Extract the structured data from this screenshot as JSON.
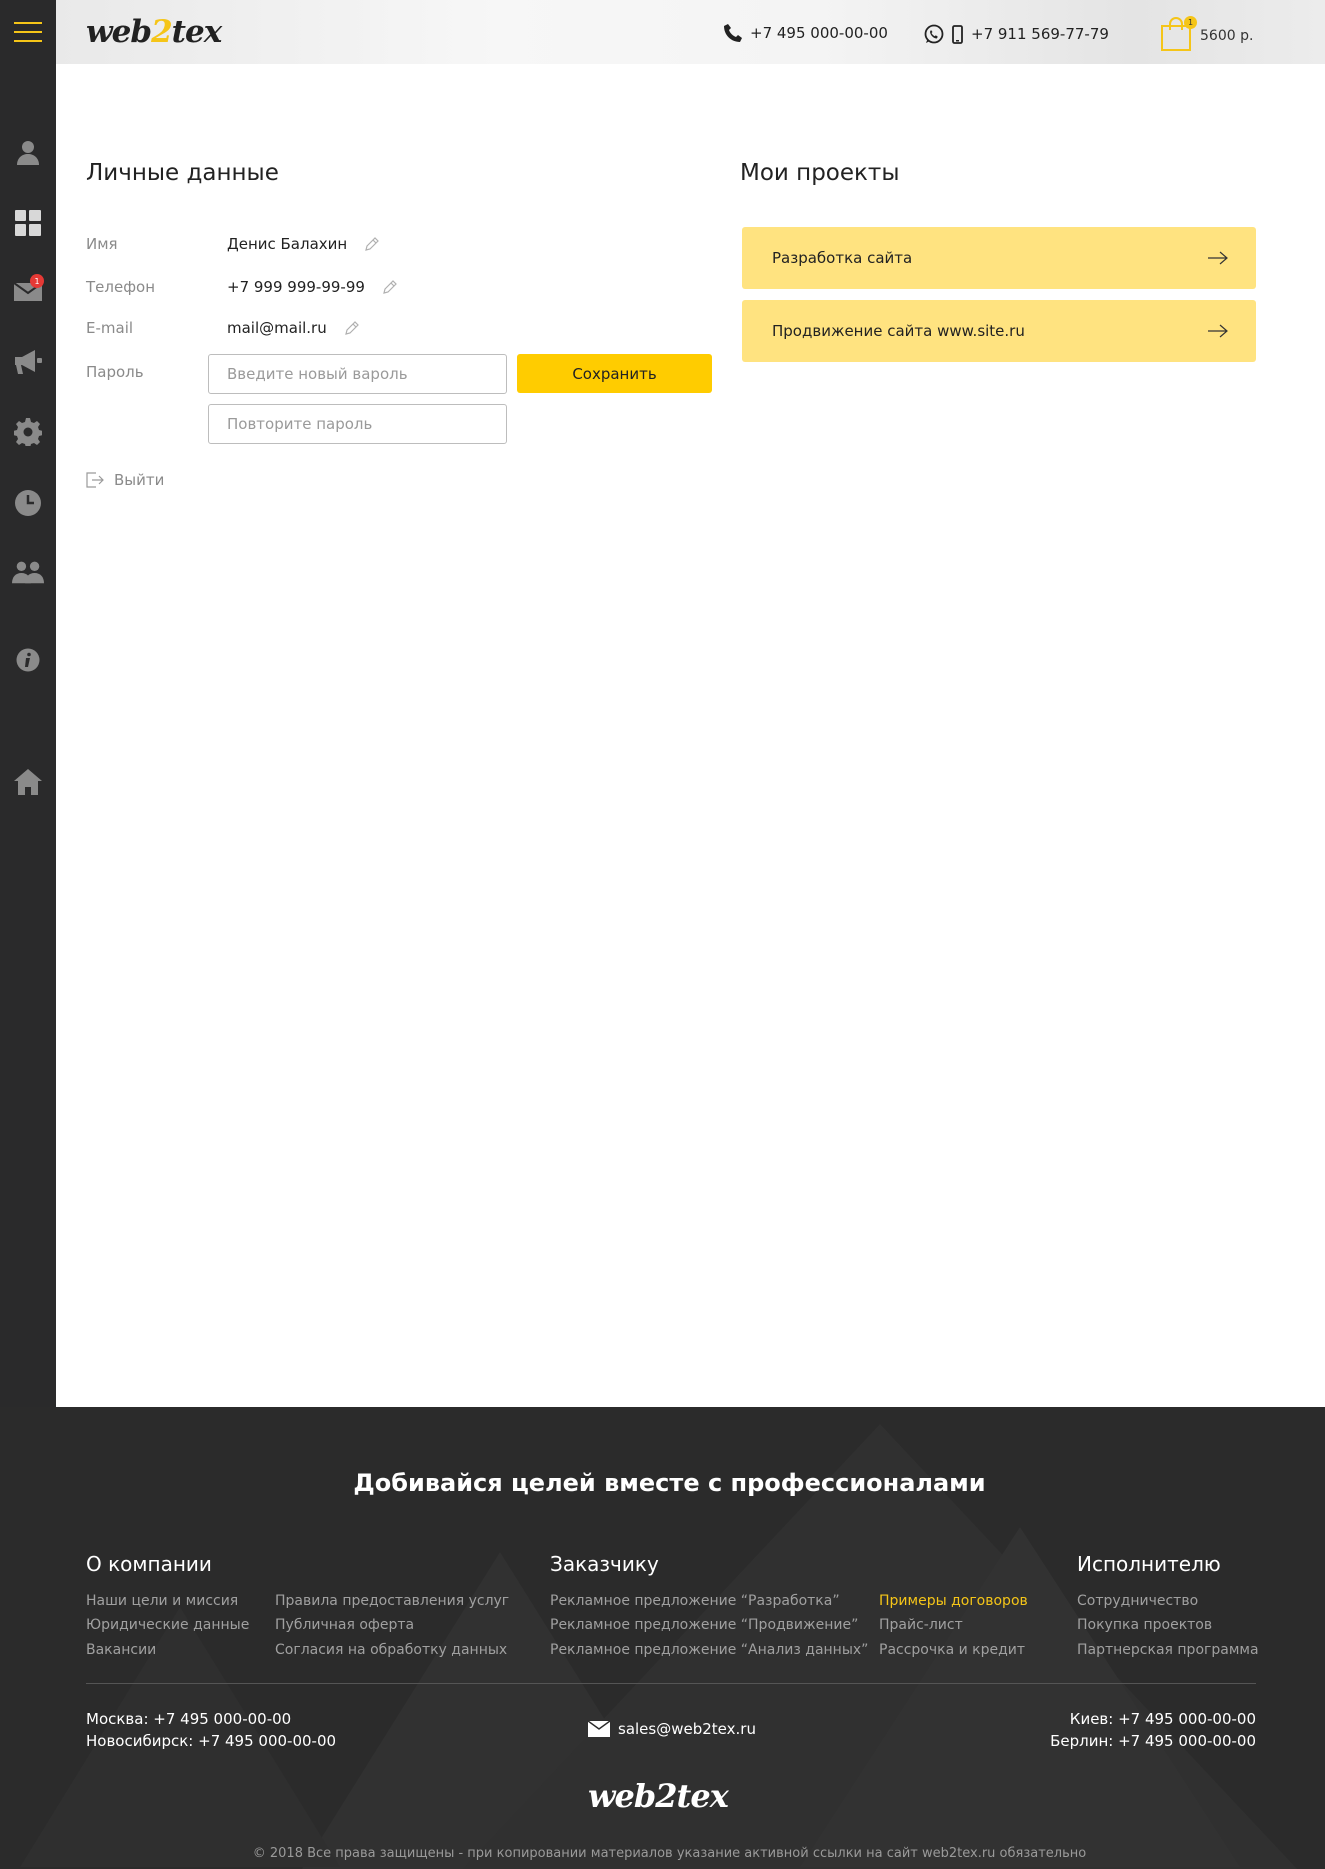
{
  "header": {
    "logo_pre": "web",
    "logo_two": "2",
    "logo_post": "tex",
    "phone_main": "+7 495 000-00-00",
    "phone_mobile": "+7 911 569-77-79",
    "cart_count": "1",
    "cart_sum": "5600 р."
  },
  "sidebar": {
    "icons": [
      "menu-icon",
      "user-icon",
      "dashboard-icon",
      "mail-icon",
      "megaphone-icon",
      "gear-icon",
      "clock-icon",
      "users-icon",
      "info-icon",
      "home-icon"
    ],
    "mail_badge": "1"
  },
  "personal": {
    "title": "Личные данные",
    "name_label": "Имя",
    "name_value": "Денис Балахин",
    "phone_label": "Телефон",
    "phone_value": "+7 999 999-99-99",
    "email_label": "E-mail",
    "email_value": "mail@mail.ru",
    "password_label": "Пароль",
    "password_placeholder": "Введите новый вароль",
    "password_repeat_placeholder": "Повторите пароль",
    "save_label": "Сохранить",
    "logout_label": "Выйти"
  },
  "projects": {
    "title": "Мои проекты",
    "items": [
      {
        "label": "Разработка сайта"
      },
      {
        "label": "Продвижение сайта www.site.ru"
      }
    ]
  },
  "footer": {
    "slogan": "Добивайся целей вместе с профессионалами",
    "company": {
      "title": "О компании",
      "links": [
        "Наши цели и миссия",
        "Юридические данные",
        "Вакансии",
        "Правила предоставления услуг",
        "Публичная оферта",
        "Согласия на обработку данных"
      ]
    },
    "customer": {
      "title": "Заказчику",
      "links": [
        "Рекламное предложение “Разработка”",
        "Рекламное предложение “Продвижение”",
        "Рекламное предложение “Анализ данных”",
        "Примеры договоров",
        "Прайс-лист",
        "Рассрочка и кредит"
      ]
    },
    "executor": {
      "title": "Исполнителю",
      "links": [
        "Сотрудничество",
        "Покупка проектов",
        "Партнерская программа"
      ]
    },
    "contacts": {
      "moscow": "Москва: +7 495 000-00-00",
      "novosibirsk": "Новосибирск: +7 495 000-00-00",
      "email": "sales@web2tex.ru",
      "kiev": "Киев: +7 495 000-00-00",
      "berlin": "Берлин: +7 495 000-00-00"
    },
    "logo": "web2tex",
    "copyright": "© 2018 Все права защищены - при копировании материалов указание активной ссылки на сайт web2tex.ru обязательно"
  },
  "colors": {
    "accent": "#ffcc00",
    "project_bg": "#ffe380",
    "sidebar_bg": "#2a2a2b",
    "footer_bg": "#2b2b2b",
    "badge": "#e53935"
  }
}
